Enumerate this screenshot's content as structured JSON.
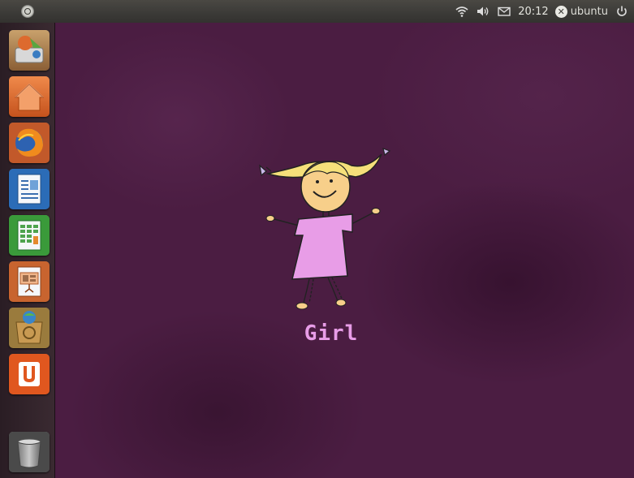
{
  "top_panel": {
    "clock": "20:12",
    "username": "ubuntu",
    "icons": [
      "ubuntu-logo-icon",
      "wifi-icon",
      "volume-icon",
      "mail-icon",
      "session-icon",
      "power-icon"
    ]
  },
  "launcher": {
    "items": [
      {
        "name": "ubuntu-installer",
        "icon": "installer-icon"
      },
      {
        "name": "home-folder",
        "icon": "home-icon"
      },
      {
        "name": "firefox",
        "icon": "firefox-icon"
      },
      {
        "name": "libreoffice-writer",
        "icon": "writer-icon"
      },
      {
        "name": "libreoffice-calc",
        "icon": "calc-icon"
      },
      {
        "name": "libreoffice-impress",
        "icon": "impress-icon"
      },
      {
        "name": "ubuntu-software-center",
        "icon": "software-center-icon"
      },
      {
        "name": "ubuntu-one",
        "icon": "ubuntu-one-icon"
      },
      {
        "name": "trash",
        "icon": "trash-icon"
      }
    ]
  },
  "desktop": {
    "wallpaper_caption": "Girl",
    "colors": {
      "background": "#4b1d42",
      "dress": "#e89de7",
      "hair": "#f5e07a",
      "skin": "#f7cf8a"
    }
  }
}
